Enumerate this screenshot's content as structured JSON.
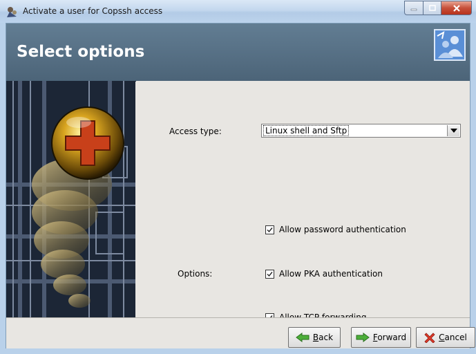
{
  "window": {
    "title": "Activate a user for Copssh access"
  },
  "header": {
    "title": "Select options"
  },
  "form": {
    "access_type_label": "Access type:",
    "access_type_value": "Linux shell and Sftp",
    "options_label": "Options:",
    "options": [
      {
        "label": "Allow password authentication",
        "checked": true
      },
      {
        "label": "Allow PKA authentication",
        "checked": true
      },
      {
        "label": "Allow TCP forwarding",
        "checked": true
      }
    ]
  },
  "footer": {
    "back_mnemonic": "B",
    "back_rest": "ack",
    "forward_mnemonic": "F",
    "forward_rest": "orward",
    "cancel_mnemonic": "C",
    "cancel_rest": "ancel"
  },
  "colors": {
    "header_bg": "#5a7388",
    "header_text": "#ffffff",
    "content_bg": "#e8e6e2",
    "close_button": "#c7503a"
  }
}
